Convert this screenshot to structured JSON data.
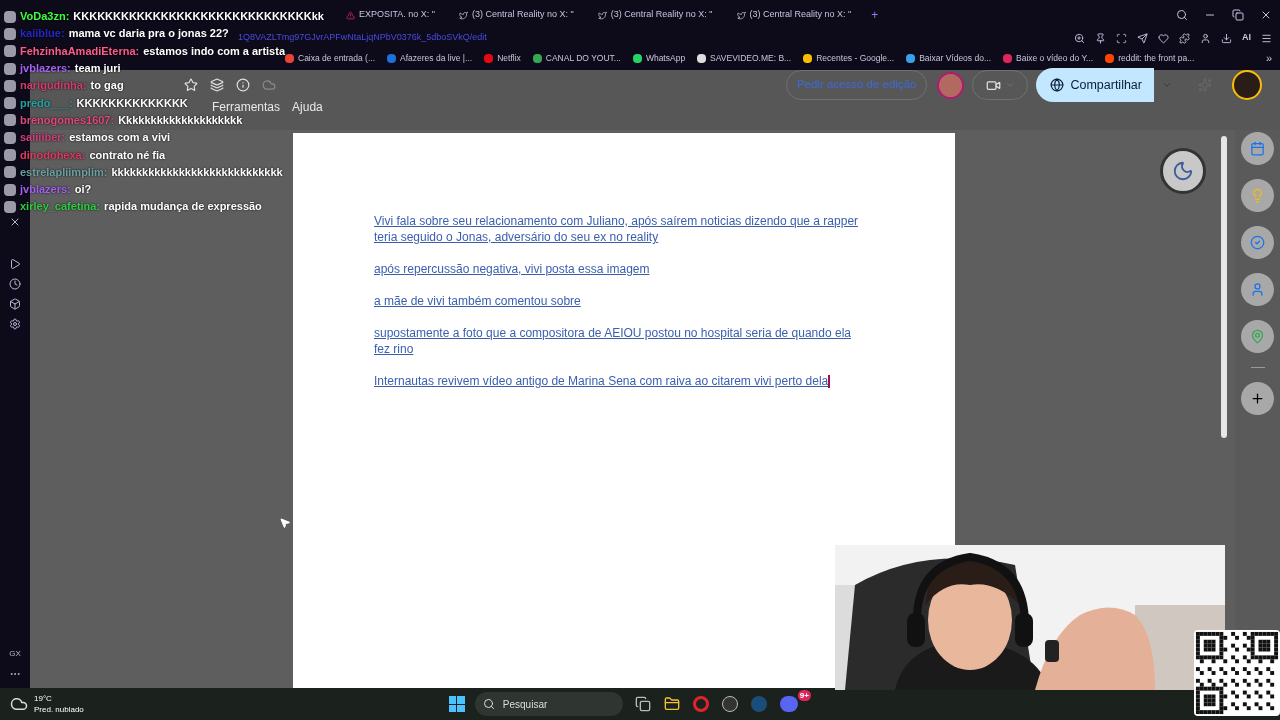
{
  "chat": [
    {
      "user": "VoDa3zn:",
      "color": "#3cff3c",
      "message": "KKKKKKKKKKKKKKKKKKKKKKKKKKKKKKkk"
    },
    {
      "user": "kaiiblue:",
      "color": "#2626c8",
      "message": "mama vc daria pra o jonas 22?"
    },
    {
      "user": "FehzinhaAmadiEterna:",
      "color": "#ff5c8a",
      "message": "estamos indo com a artista"
    },
    {
      "user": "jvblazers:",
      "color": "#a462f2",
      "message": "team juri"
    },
    {
      "user": "narigudinha:",
      "color": "#d43c6c",
      "message": "to gag"
    },
    {
      "user": "predo___:",
      "color": "#1fa6a6",
      "message": "KKKKKKKKKKKKKK"
    },
    {
      "user": "brenogomes1607:",
      "color": "#e04a7a",
      "message": "Kkkkkkkkkkkkkkkkkkkk"
    },
    {
      "user": "saiiiiber:",
      "color": "#d0407a",
      "message": "estamos com a vivi"
    },
    {
      "user": "dinodohexa:",
      "color": "#e03a60",
      "message": "contrato né fia"
    },
    {
      "user": "estrelapliimplim:",
      "color": "#6aa0a0",
      "message": "kkkkkkkkkkkkkkkkkkkkkkkkkkkk"
    },
    {
      "user": "jvblazers:",
      "color": "#a462f2",
      "message": "oi?"
    },
    {
      "user": "xirley_cafetina:",
      "color": "#2ecc40",
      "message": "rapida mudança de expressão"
    }
  ],
  "browser": {
    "tabs": [
      {
        "label": "EXPOSITA. no X: \"",
        "selected": false
      },
      {
        "label": "(3) Central Reality no X: \"",
        "selected": false
      },
      {
        "label": "(3) Central Reality no X: \"",
        "selected": false
      },
      {
        "label": "(3) Central Reality no X: \"",
        "selected": false
      }
    ],
    "new_tab": "+",
    "url": "1Q8VAZLTmg97GJvrAPFwNtaLjqNPbV0376k_5dboSVkQ/edit",
    "ai_label": "AI",
    "bookmarks": [
      {
        "label": "Caixa de entrada (...",
        "color": "#ea4335"
      },
      {
        "label": "Afazeres da live |...",
        "color": "#1f6fd8"
      },
      {
        "label": "Netflix",
        "color": "#e50914"
      },
      {
        "label": "CANAL DO YOUT...",
        "color": "#34a853"
      },
      {
        "label": "WhatsApp",
        "color": "#25d366"
      },
      {
        "label": "SAVEVIDEO.ME: B...",
        "color": "#dddddd"
      },
      {
        "label": "Recentes - Google...",
        "color": "#fbbc04"
      },
      {
        "label": "Baixar Vídeos do...",
        "color": "#3aa0e8"
      },
      {
        "label": "Baixe o vídeo do Y...",
        "color": "#e0245e"
      },
      {
        "label": "reddit: the front pa...",
        "color": "#ff4500"
      }
    ],
    "more": "»"
  },
  "docs": {
    "menu": [
      "Ferramentas",
      "Ajuda"
    ],
    "request_edit": "Pedir acesso de edição",
    "share": "Compartilhar",
    "paragraphs": [
      "Vivi fala sobre seu relacionamento com Juliano, após saírem noticias dizendo que a rapper teria seguido o Jonas, adversário do seu ex no reality",
      "após repercussão negativa, vivi posta essa imagem",
      "a mãe de vivi também comentou sobre",
      "supostamente a foto que a compositora de AEIOU postou no hospital seria de quando ela fez rino",
      "Internautas revivem vídeo antigo de Marina Sena com raiva ao citarem vivi perto dela"
    ]
  },
  "sidebar": {
    "label": "GX"
  },
  "taskbar": {
    "temperature": "19°C",
    "condition": "Pred. nublado",
    "search": "Pesquisar",
    "discord_badge": "9+"
  }
}
